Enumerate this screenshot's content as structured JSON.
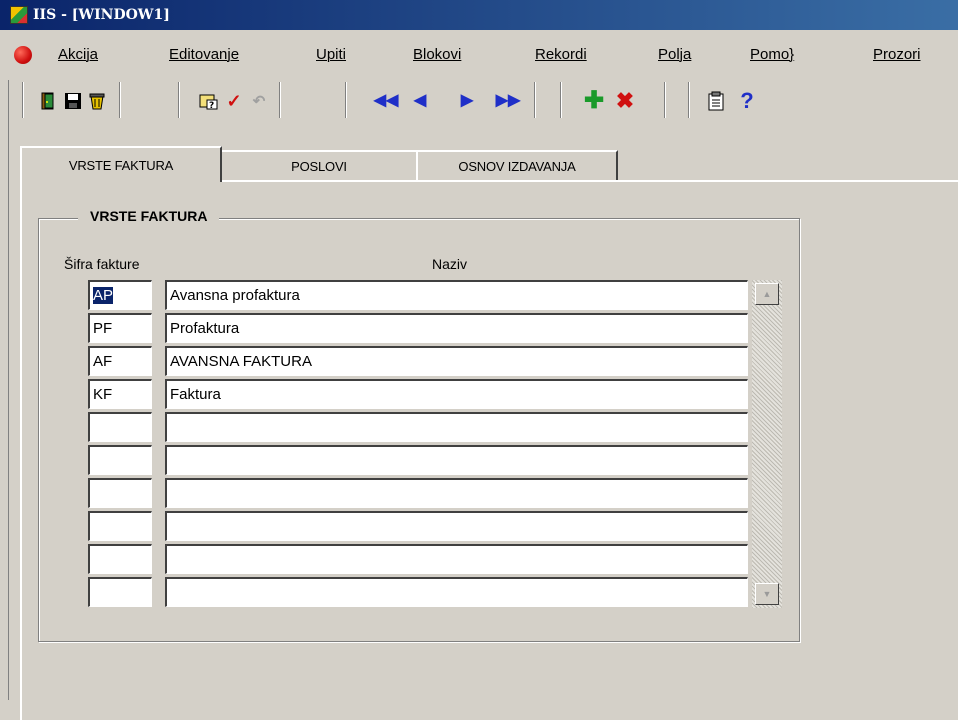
{
  "window": {
    "title": "IIS - [WINDOW1]"
  },
  "menu": {
    "items": [
      "Akcija",
      "Editovanje",
      "Upiti",
      "Blokovi",
      "Rekordi",
      "Polja",
      "Pomo}",
      "Prozori"
    ]
  },
  "toolbar": {
    "icons": [
      "exit-door-icon",
      "save-disk-icon",
      "clear-bucket-icon",
      "enter-query-icon",
      "execute-query-check-icon",
      "cancel-query-icon",
      "previous-block-icon",
      "previous-record-icon",
      "next-record-icon",
      "next-block-icon",
      "insert-record-icon",
      "delete-record-icon",
      "list-of-values-icon",
      "help-icon"
    ]
  },
  "tabs": [
    "VRSTE FAKTURA",
    "POSLOVI",
    "OSNOV IZDAVANJA"
  ],
  "active_tab": "VRSTE FAKTURA",
  "group": {
    "title": "VRSTE FAKTURA"
  },
  "columns": {
    "code": "Šifra fakture",
    "name": "Naziv"
  },
  "records": [
    {
      "code": "AP",
      "name": "Avansna profaktura"
    },
    {
      "code": "PF",
      "name": "Profaktura"
    },
    {
      "code": "AF",
      "name": "AVANSNA FAKTURA"
    },
    {
      "code": "KF",
      "name": "Faktura"
    },
    {
      "code": "",
      "name": ""
    },
    {
      "code": "",
      "name": ""
    },
    {
      "code": "",
      "name": ""
    },
    {
      "code": "",
      "name": ""
    },
    {
      "code": "",
      "name": ""
    },
    {
      "code": "",
      "name": ""
    }
  ],
  "colors": {
    "titlebar": "#0a246a",
    "selection": "#0a246a",
    "nav_icons": "#1f2fc8",
    "delete_icon": "#d01010",
    "insert_icon": "#1a9a2a"
  }
}
